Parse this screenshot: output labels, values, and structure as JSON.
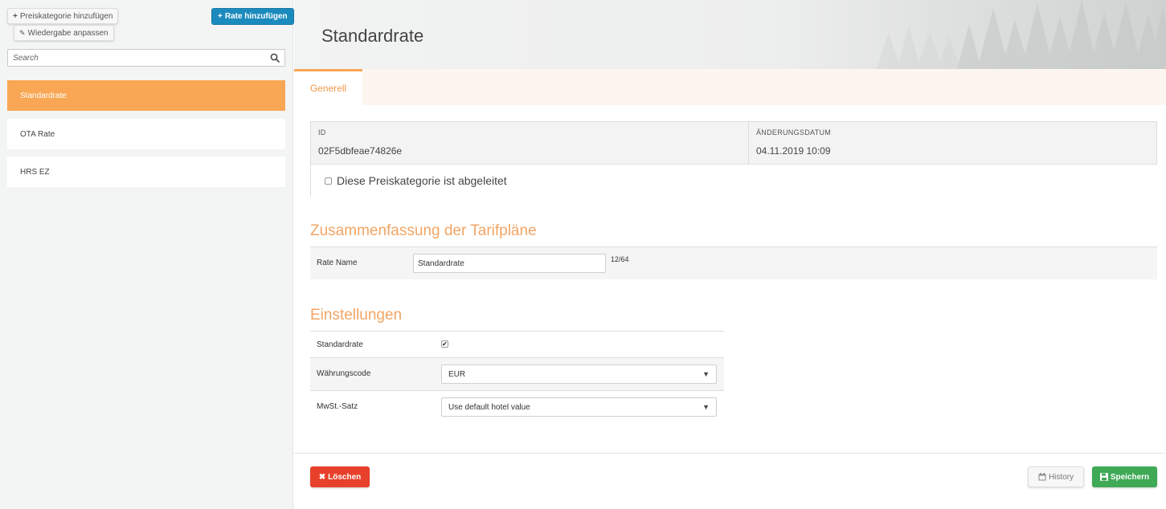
{
  "sidebar": {
    "add_category_label": "Preiskategorie hinzufügen",
    "adjust_display_label": "Wiedergabe anpassen",
    "add_rate_label": "Rate hinzufügen",
    "search_placeholder": "Search",
    "items": [
      {
        "label": "Standardrate",
        "active": true
      },
      {
        "label": "OTA Rate",
        "active": false
      },
      {
        "label": "HRS EZ",
        "active": false
      }
    ]
  },
  "header": {
    "title": "Standardrate"
  },
  "tabs": [
    {
      "label": "Generell",
      "active": true
    }
  ],
  "info": {
    "id_label": "ID",
    "id_value": "02F5dbfeae74826e",
    "changed_label": "ÄNDERUNGSDATUM",
    "changed_value": "04.11.2019 10:09"
  },
  "derived_label": "Diese Preiskategorie ist abgeleitet",
  "summary": {
    "title": "Zusammenfassung der Tarifpläne",
    "rate_name_label": "Rate Name",
    "rate_name_value": "Standardrate",
    "counter": "12/64"
  },
  "settings": {
    "title": "Einstellungen",
    "standardrate_label": "Standardrate",
    "standardrate_checked": true,
    "currency_label": "Währungscode",
    "currency_value": "EUR",
    "vat_label": "MwSt.-Satz",
    "vat_value": "Use default hotel value"
  },
  "footer": {
    "delete_label": "Löschen",
    "history_label": "History",
    "save_label": "Speichern"
  },
  "colors": {
    "accent": "#f9a754",
    "primary": "#1b8bbd",
    "danger": "#e8412b",
    "success": "#3fa956"
  }
}
